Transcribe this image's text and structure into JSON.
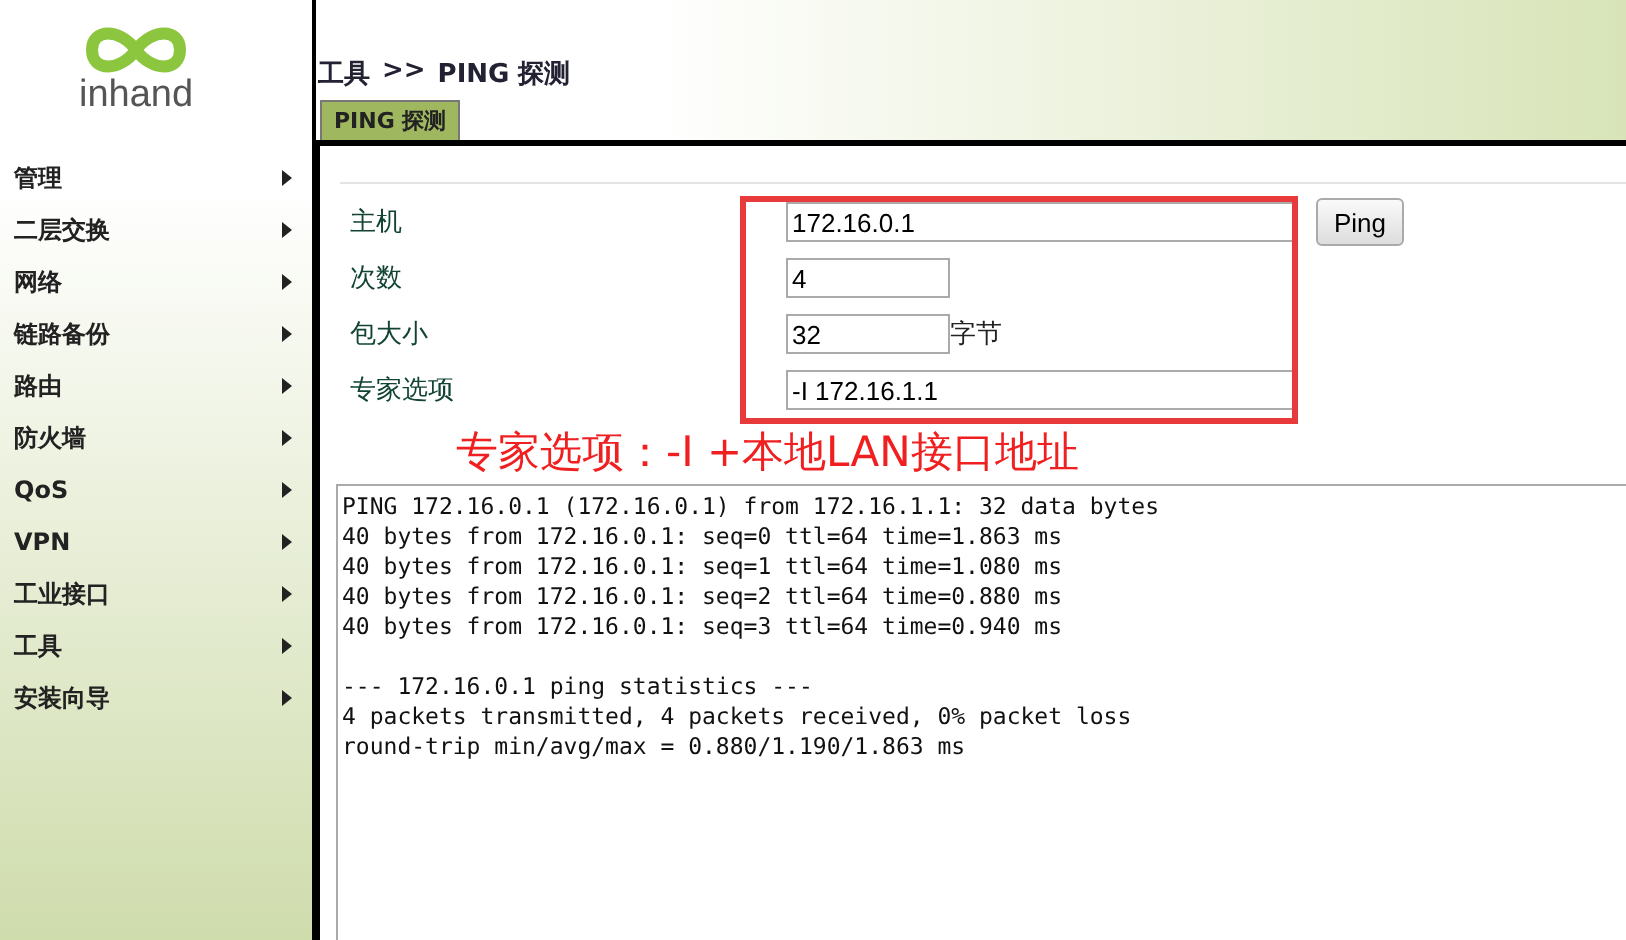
{
  "logo": {
    "text": "inhand"
  },
  "breadcrumb": {
    "section": "工具",
    "separator": ">>",
    "page": "PING 探测"
  },
  "tabs": [
    {
      "label": "PING 探测",
      "selected": true
    }
  ],
  "sidebar": {
    "items": [
      {
        "label": "管理"
      },
      {
        "label": "二层交换"
      },
      {
        "label": "网络"
      },
      {
        "label": "链路备份"
      },
      {
        "label": "路由"
      },
      {
        "label": "防火墙"
      },
      {
        "label": "QoS"
      },
      {
        "label": "VPN"
      },
      {
        "label": "工业接口"
      },
      {
        "label": "工具"
      },
      {
        "label": "安装向导"
      }
    ]
  },
  "form": {
    "fields": [
      {
        "kind": "wide",
        "label": "主机",
        "value": "172.16.0.1"
      },
      {
        "kind": "short",
        "label": "次数",
        "value": "4"
      },
      {
        "kind": "short",
        "label": "包大小",
        "value": "32",
        "unit": "字节"
      },
      {
        "kind": "wide",
        "label": "专家选项",
        "value": "-I 172.16.1.1"
      }
    ],
    "button": "Ping"
  },
  "annotation": {
    "text": "专家选项：-I +本地LAN接口地址"
  },
  "output": {
    "blocks": [
      [
        "PING 172.16.0.1 (172.16.0.1) from 172.16.1.1: 32 data bytes",
        "40 bytes from 172.16.0.1: seq=0 ttl=64 time=1.863 ms",
        "40 bytes from 172.16.0.1: seq=1 ttl=64 time=1.080 ms",
        "40 bytes from 172.16.0.1: seq=2 ttl=64 time=0.880 ms",
        "40 bytes from 172.16.0.1: seq=3 ttl=64 time=0.940 ms"
      ],
      [
        "--- 172.16.0.1 ping statistics ---",
        "4 packets transmitted, 4 packets received, 0% packet loss",
        "round-trip min/avg/max = 0.880/1.190/1.863 ms"
      ]
    ]
  }
}
